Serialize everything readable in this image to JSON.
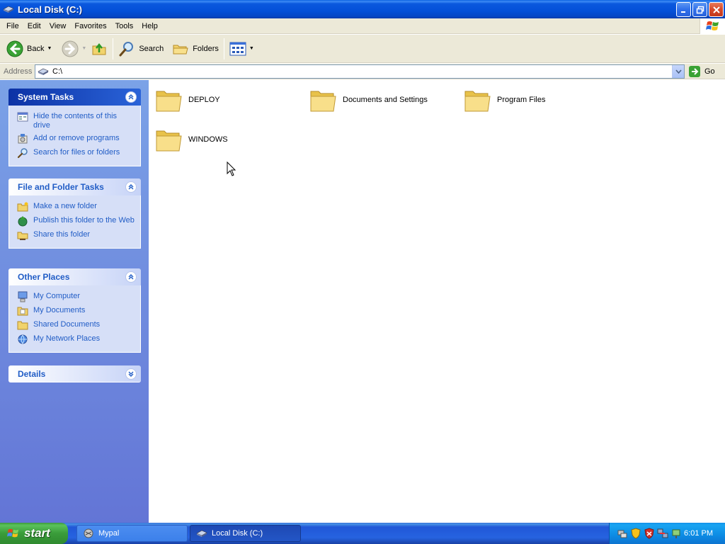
{
  "window": {
    "title": "Local Disk (C:)",
    "icon": "drive-icon"
  },
  "menu": {
    "items": [
      "File",
      "Edit",
      "View",
      "Favorites",
      "Tools",
      "Help"
    ]
  },
  "toolbar": {
    "back_label": "Back",
    "search_label": "Search",
    "folders_label": "Folders"
  },
  "address": {
    "label": "Address",
    "value": "C:\\",
    "go_label": "Go"
  },
  "panels": {
    "system_tasks": {
      "title": "System Tasks",
      "items": [
        {
          "label": "Hide the contents of this drive",
          "icon": "hide-contents-icon"
        },
        {
          "label": "Add or remove programs",
          "icon": "add-remove-programs-icon"
        },
        {
          "label": "Search for files or folders",
          "icon": "search-icon"
        }
      ]
    },
    "file_folder_tasks": {
      "title": "File and Folder Tasks",
      "items": [
        {
          "label": "Make a new folder",
          "icon": "new-folder-icon"
        },
        {
          "label": "Publish this folder to the Web",
          "icon": "publish-web-icon"
        },
        {
          "label": "Share this folder",
          "icon": "share-folder-icon"
        }
      ]
    },
    "other_places": {
      "title": "Other Places",
      "items": [
        {
          "label": "My Computer",
          "icon": "my-computer-icon"
        },
        {
          "label": "My Documents",
          "icon": "my-documents-icon"
        },
        {
          "label": "Shared Documents",
          "icon": "shared-documents-icon"
        },
        {
          "label": "My Network Places",
          "icon": "network-places-icon"
        }
      ]
    },
    "details": {
      "title": "Details"
    }
  },
  "folders": [
    {
      "name": "DEPLOY"
    },
    {
      "name": "Documents and Settings"
    },
    {
      "name": "Program Files"
    },
    {
      "name": "WINDOWS"
    }
  ],
  "taskbar": {
    "start_label": "start",
    "tasks": [
      {
        "label": "Mypal",
        "active": false
      },
      {
        "label": "Local Disk (C:)",
        "active": true
      }
    ],
    "clock": "6:01 PM"
  },
  "colors": {
    "title_bar": "#0450d8",
    "left_pane_top": "#7ba2e7",
    "left_pane_bottom": "#6375d6",
    "panel_link": "#215dc6",
    "taskbar": "#2663e0",
    "start_button": "#3a9c3a"
  }
}
